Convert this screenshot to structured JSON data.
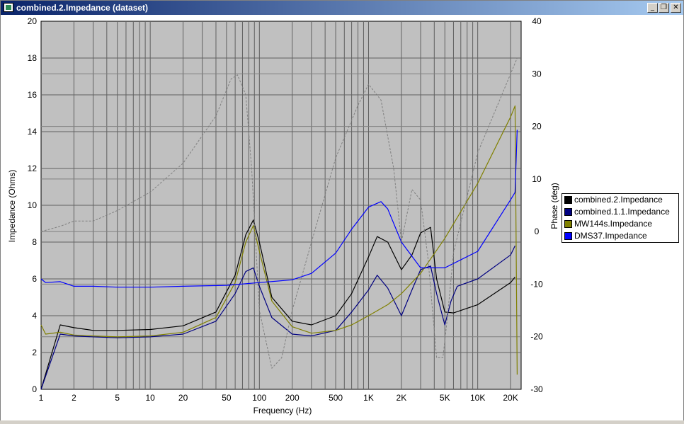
{
  "window": {
    "title": "combined.2.Impedance (dataset)",
    "minimize": "_",
    "restore": "❐",
    "close": "✕"
  },
  "legend": [
    {
      "label": "combined.2.Impedance",
      "color": "#000000"
    },
    {
      "label": "combined.1.1.Impedance",
      "color": "#000080"
    },
    {
      "label": "MW144s.Impedance",
      "color": "#808000"
    },
    {
      "label": "DMS37.Impedance",
      "color": "#0000ff"
    }
  ],
  "chart_data": {
    "type": "line",
    "xlabel": "Frequency (Hz)",
    "ylabel": "Impedance (Ohms)",
    "y2label": "Phase (deg)",
    "xscale": "log",
    "xlim": [
      1,
      25000
    ],
    "ylim": [
      0,
      20
    ],
    "y2lim": [
      -30,
      40
    ],
    "grid": true,
    "legend_position": "right",
    "plot_background": "#c0c0c0",
    "xticks": [
      {
        "v": 1,
        "label": "1"
      },
      {
        "v": 2,
        "label": "2"
      },
      {
        "v": 5,
        "label": "5"
      },
      {
        "v": 10,
        "label": "10"
      },
      {
        "v": 20,
        "label": "20"
      },
      {
        "v": 50,
        "label": "50"
      },
      {
        "v": 100,
        "label": "100"
      },
      {
        "v": 200,
        "label": "200"
      },
      {
        "v": 500,
        "label": "500"
      },
      {
        "v": 1000,
        "label": "1K"
      },
      {
        "v": 2000,
        "label": "2K"
      },
      {
        "v": 5000,
        "label": "5K"
      },
      {
        "v": 10000,
        "label": "10K"
      },
      {
        "v": 20000,
        "label": "20K"
      }
    ],
    "yticks": [
      0,
      2,
      4,
      6,
      8,
      10,
      12,
      14,
      16,
      18,
      20
    ],
    "y2ticks": [
      -30,
      -20,
      -10,
      0,
      10,
      20,
      30,
      40
    ],
    "series": [
      {
        "name": "combined.2.Impedance",
        "color": "#000000",
        "axis": "left",
        "x": [
          1,
          1.5,
          2,
          3,
          5,
          10,
          20,
          40,
          60,
          75,
          88,
          100,
          130,
          200,
          300,
          500,
          700,
          1000,
          1200,
          1500,
          2000,
          2500,
          3000,
          3700,
          4200,
          5000,
          6000,
          10000,
          20000,
          22000
        ],
        "y": [
          0,
          3.5,
          3.35,
          3.2,
          3.2,
          3.25,
          3.45,
          4.2,
          6.2,
          8.4,
          9.2,
          8.0,
          5.0,
          3.7,
          3.5,
          4.0,
          5.2,
          7.2,
          8.3,
          8.0,
          6.5,
          7.3,
          8.5,
          8.8,
          6.0,
          4.2,
          4.15,
          4.6,
          5.8,
          6.1
        ]
      },
      {
        "name": "combined.1.1.Impedance",
        "color": "#000080",
        "axis": "left",
        "x": [
          1,
          1.5,
          2,
          3,
          5,
          10,
          20,
          40,
          60,
          75,
          88,
          100,
          130,
          200,
          300,
          500,
          700,
          1000,
          1200,
          1500,
          2000,
          2500,
          3000,
          3700,
          4200,
          5000,
          5700,
          6500,
          10000,
          20000,
          22000
        ],
        "y": [
          0,
          3.0,
          2.9,
          2.85,
          2.8,
          2.85,
          3.0,
          3.7,
          5.2,
          6.4,
          6.6,
          5.6,
          3.9,
          3.0,
          2.9,
          3.2,
          4.2,
          5.4,
          6.2,
          5.5,
          4.0,
          5.4,
          6.5,
          6.7,
          5.2,
          3.5,
          4.8,
          5.6,
          6.0,
          7.3,
          7.8
        ]
      },
      {
        "name": "MW144s.Impedance",
        "color": "#808000",
        "axis": "left",
        "x": [
          1,
          1.1,
          1.5,
          2,
          3,
          5,
          10,
          20,
          40,
          60,
          75,
          88,
          100,
          130,
          200,
          300,
          500,
          700,
          1000,
          1500,
          2000,
          3000,
          5000,
          10000,
          20000,
          22000,
          23000
        ],
        "y": [
          3.5,
          3.0,
          3.1,
          2.95,
          2.9,
          2.85,
          2.9,
          3.1,
          3.9,
          5.8,
          8.0,
          8.9,
          7.5,
          4.8,
          3.4,
          3.05,
          3.2,
          3.5,
          4.0,
          4.6,
          5.2,
          6.3,
          8.2,
          11.2,
          14.8,
          15.4,
          0.8
        ]
      },
      {
        "name": "DMS37.Impedance",
        "color": "#0000ff",
        "axis": "left",
        "x": [
          1,
          1.1,
          1.5,
          2,
          3,
          5,
          10,
          20,
          50,
          100,
          200,
          300,
          500,
          700,
          1000,
          1300,
          1500,
          2000,
          3000,
          5000,
          10000,
          20000,
          22000,
          23000
        ],
        "y": [
          6.0,
          5.8,
          5.85,
          5.6,
          5.6,
          5.55,
          5.55,
          5.6,
          5.65,
          5.8,
          5.95,
          6.3,
          7.4,
          8.7,
          9.9,
          10.2,
          9.8,
          8.0,
          6.6,
          6.6,
          7.5,
          10.3,
          10.7,
          14.1
        ]
      },
      {
        "name": "",
        "color": "#808080",
        "axis": "right",
        "dashed": true,
        "x": [
          1,
          1.5,
          2,
          3,
          5,
          10,
          20,
          40,
          55,
          63,
          75,
          85,
          100,
          130,
          160,
          200,
          300,
          500,
          800,
          1000,
          1300,
          1700,
          2000,
          2500,
          3000,
          3500,
          4200,
          4800,
          5300,
          6000,
          10000,
          20000,
          23000
        ],
        "y": [
          0,
          1,
          2,
          2,
          4,
          7.5,
          13,
          22,
          29,
          29.8,
          26,
          12,
          -15,
          -26,
          -24,
          -15,
          -2,
          14,
          24,
          28,
          25,
          12,
          -2,
          8,
          6,
          -5,
          -24,
          -24,
          -16,
          -4,
          15,
          30,
          33
        ]
      }
    ]
  }
}
